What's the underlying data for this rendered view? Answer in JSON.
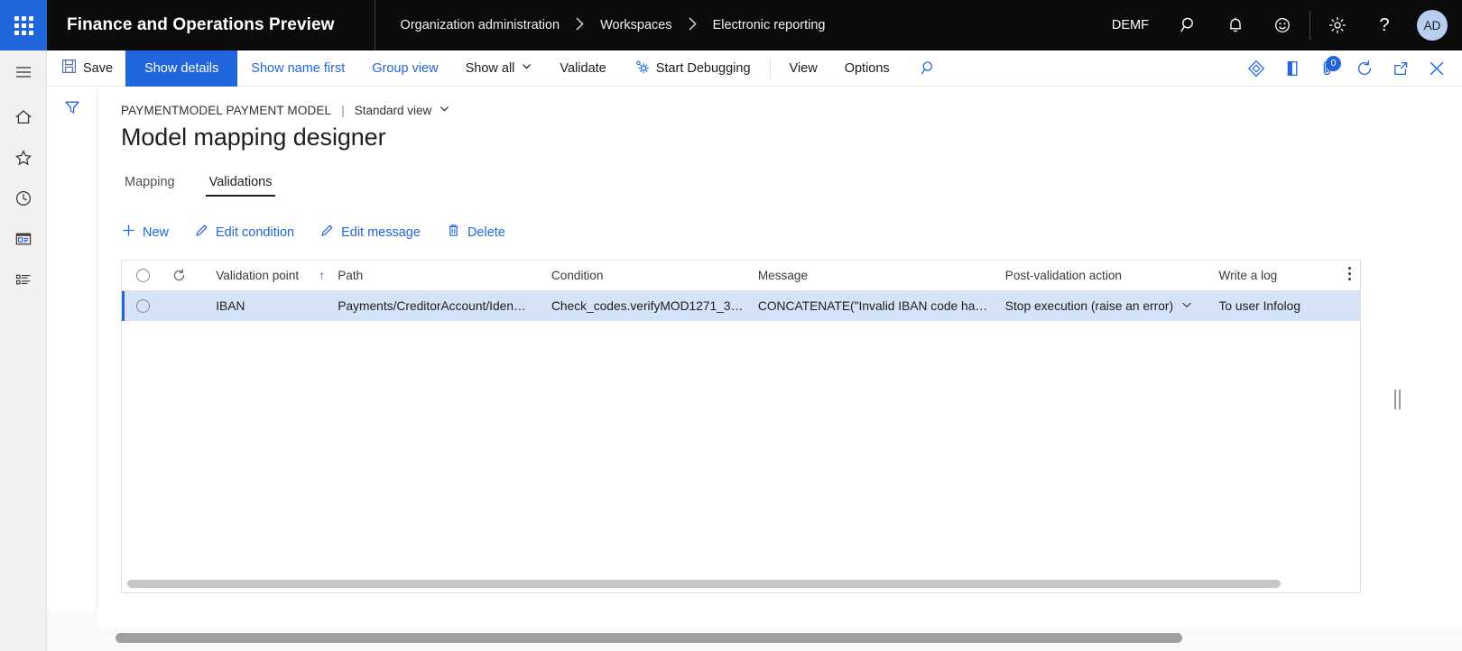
{
  "topbar": {
    "waffle_label": "app-launcher",
    "app_title": "Finance and Operations Preview",
    "breadcrumb": [
      {
        "label": "Organization administration"
      },
      {
        "label": "Workspaces"
      },
      {
        "label": "Electronic reporting"
      }
    ],
    "breadcrumb_separator": "›",
    "company": "DEMF",
    "icons": [
      {
        "name": "search-icon",
        "glyph": "⌕"
      },
      {
        "name": "notifications-bell-icon",
        "glyph": "🔔"
      },
      {
        "name": "feedback-smiley-icon",
        "glyph": "☺"
      },
      {
        "name": "settings-gear-icon",
        "glyph": "⚙"
      },
      {
        "name": "help-question-icon",
        "glyph": "?"
      }
    ],
    "avatar_initials": "AD"
  },
  "rail": {
    "items": [
      {
        "name": "navigation-menu-icon",
        "label": "Expand the navigation pane"
      },
      {
        "name": "home-icon",
        "label": "Home"
      },
      {
        "name": "favorites-star-icon",
        "label": "Favorites"
      },
      {
        "name": "recent-clock-icon",
        "label": "Recent"
      },
      {
        "name": "workspaces-icon",
        "label": "Workspaces"
      },
      {
        "name": "modules-list-icon",
        "label": "Modules"
      }
    ]
  },
  "commandbar": {
    "save": "Save",
    "show_details": "Show details",
    "show_name_first": "Show name first",
    "group_view": "Group view",
    "show_all": "Show all",
    "validate": "Validate",
    "start_debugging": "Start Debugging",
    "view": "View",
    "options": "Options",
    "search_icon": "search-icon",
    "right_icons": [
      {
        "name": "personalize-diamond-icon"
      },
      {
        "name": "open-in-office-icon"
      },
      {
        "name": "attachments-icon",
        "badge": "0"
      },
      {
        "name": "refresh-icon"
      },
      {
        "name": "open-in-new-window-icon"
      },
      {
        "name": "close-icon"
      }
    ]
  },
  "filter_pane": {
    "filter_icon": "filter-icon"
  },
  "page": {
    "model_breadcrumb": "PAYMENTMODEL PAYMENT MODEL",
    "breadcrumb_divider": "|",
    "view_selector": "Standard view",
    "title": "Model mapping designer",
    "tabs": [
      {
        "label": "Mapping",
        "selected": false
      },
      {
        "label": "Validations",
        "selected": true
      }
    ]
  },
  "actions": [
    {
      "label": "New",
      "icon": "plus-icon"
    },
    {
      "label": "Edit condition",
      "icon": "pencil-icon"
    },
    {
      "label": "Edit message",
      "icon": "pencil-icon"
    },
    {
      "label": "Delete",
      "icon": "trash-icon"
    }
  ],
  "grid": {
    "columns": [
      {
        "key": "select",
        "label": ""
      },
      {
        "key": "refresh",
        "label": ""
      },
      {
        "key": "validation_point",
        "label": "Validation point",
        "sorted": "asc"
      },
      {
        "key": "path",
        "label": "Path"
      },
      {
        "key": "condition",
        "label": "Condition"
      },
      {
        "key": "message",
        "label": "Message"
      },
      {
        "key": "post_validation_action",
        "label": "Post-validation action"
      },
      {
        "key": "write_a_log",
        "label": "Write a log"
      }
    ],
    "sort_arrow": "↑",
    "rows": [
      {
        "validation_point": "IBAN",
        "path": "Payments/CreditorAccount/Iden…",
        "condition": "Check_codes.verifyMOD1271_3…",
        "message": "CONCATENATE(\"Invalid IBAN code ha…",
        "post_validation_action": "Stop execution (raise an error)",
        "write_a_log": "To user Infolog",
        "selected": true
      }
    ],
    "column_menu_icon": "column-options-icon"
  },
  "colors": {
    "accent": "#2266dd",
    "header_bg": "#0b0b0b",
    "row_selected_bg": "#d6e2f7",
    "page_bg": "#faf9f8"
  }
}
